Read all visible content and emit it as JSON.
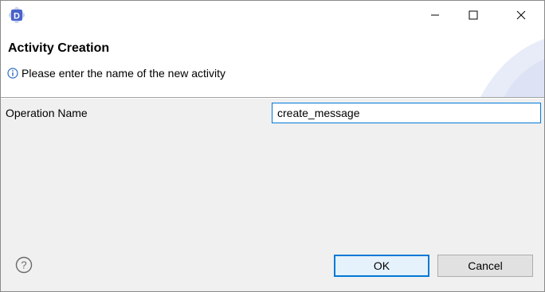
{
  "window": {
    "icon": "app-d-icon",
    "controls": {
      "minimize": "minimize-icon",
      "maximize": "maximize-icon",
      "close": "close-icon"
    }
  },
  "banner": {
    "title": "Activity Creation",
    "message": "Please enter the name of the new activity",
    "message_icon": "info-icon"
  },
  "form": {
    "label": "Operation Name",
    "value": "create_message"
  },
  "footer": {
    "help_icon": "help-icon",
    "ok_label": "OK",
    "cancel_label": "Cancel"
  },
  "colors": {
    "accent": "#0078d7",
    "window_bg": "#f0f0f0",
    "banner_bg": "#ffffff"
  }
}
